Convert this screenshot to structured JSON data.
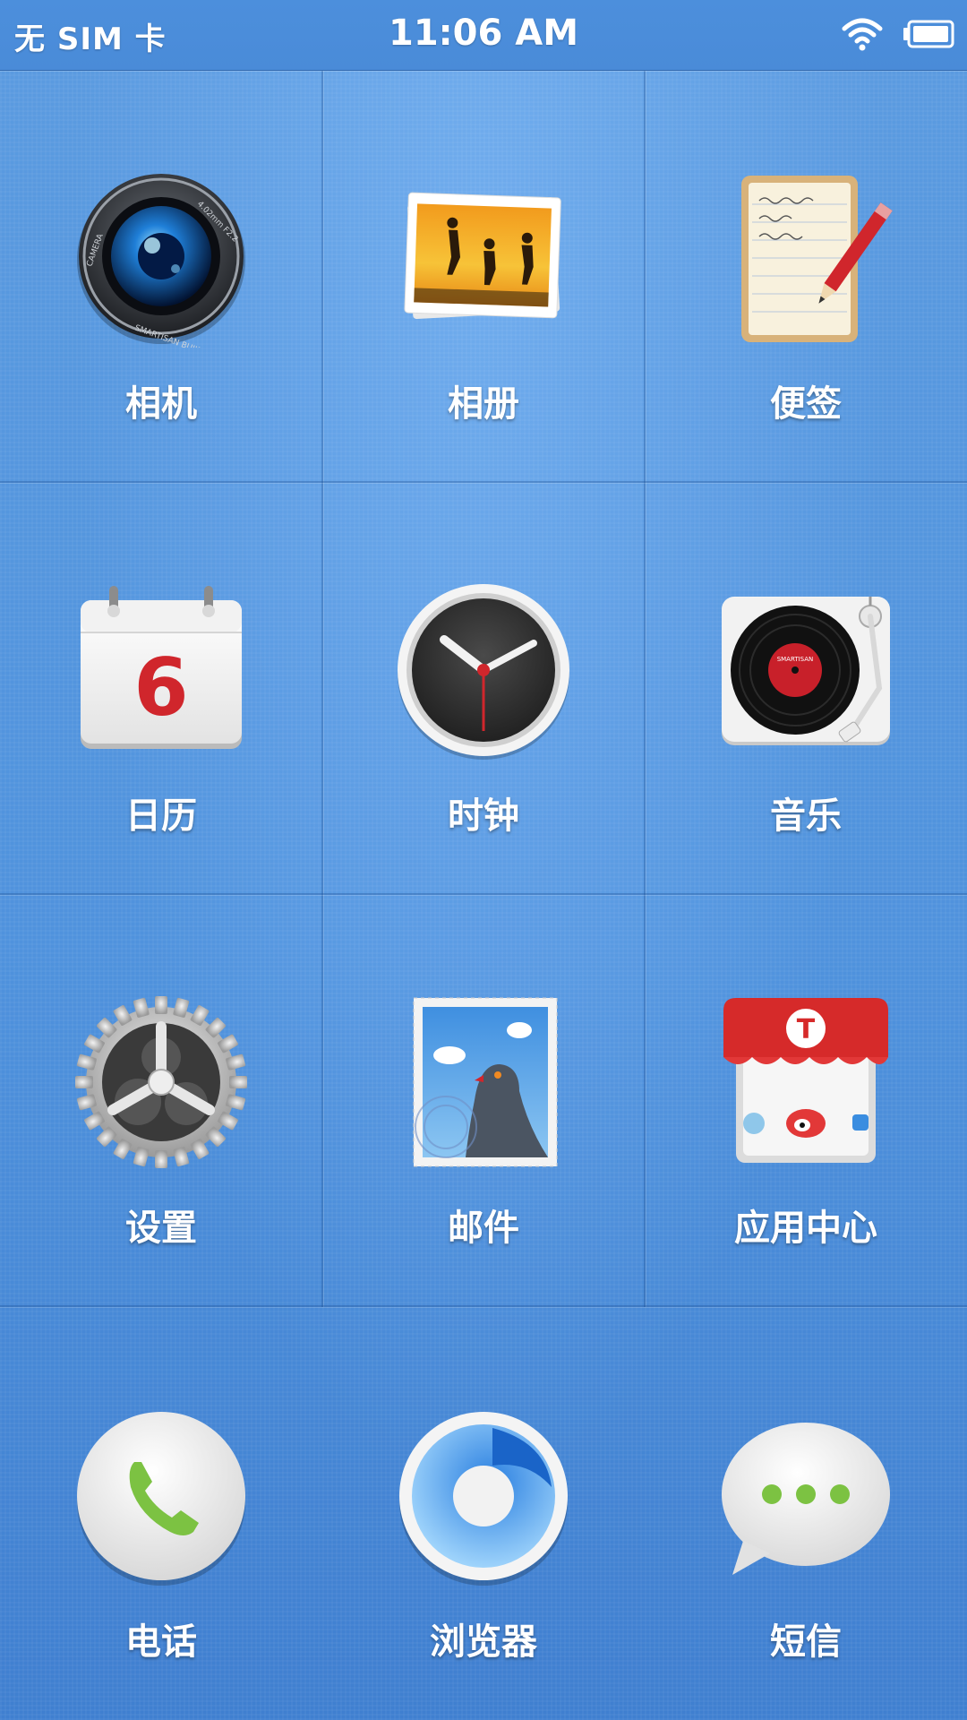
{
  "status_bar": {
    "carrier": "无 SIM 卡",
    "time": "11:06 AM",
    "wifi_icon": "wifi-icon",
    "battery_icon": "battery-icon"
  },
  "apps": [
    {
      "label": "相机",
      "icon": "camera-icon"
    },
    {
      "label": "相册",
      "icon": "photo-album-icon"
    },
    {
      "label": "便签",
      "icon": "notes-icon"
    },
    {
      "label": "日历",
      "icon": "calendar-icon"
    },
    {
      "label": "时钟",
      "icon": "clock-icon"
    },
    {
      "label": "音乐",
      "icon": "music-icon"
    },
    {
      "label": "设置",
      "icon": "settings-gear-icon"
    },
    {
      "label": "邮件",
      "icon": "mail-stamp-icon"
    },
    {
      "label": "应用中心",
      "icon": "app-store-icon"
    }
  ],
  "calendar_day": "6",
  "camera_lens_text": [
    "4.02mm F2.2",
    "SMARTISAN BUILT-IN",
    "CAMERA"
  ],
  "record_label_text": "SMARTISAN",
  "dock": [
    {
      "label": "电话",
      "icon": "phone-icon"
    },
    {
      "label": "浏览器",
      "icon": "browser-icon"
    },
    {
      "label": "短信",
      "icon": "messages-icon"
    }
  ],
  "colors": {
    "background": "#4f92dd",
    "label_text": "#ffffff",
    "accent_red": "#d0262c",
    "phone_green": "#7cc242"
  }
}
